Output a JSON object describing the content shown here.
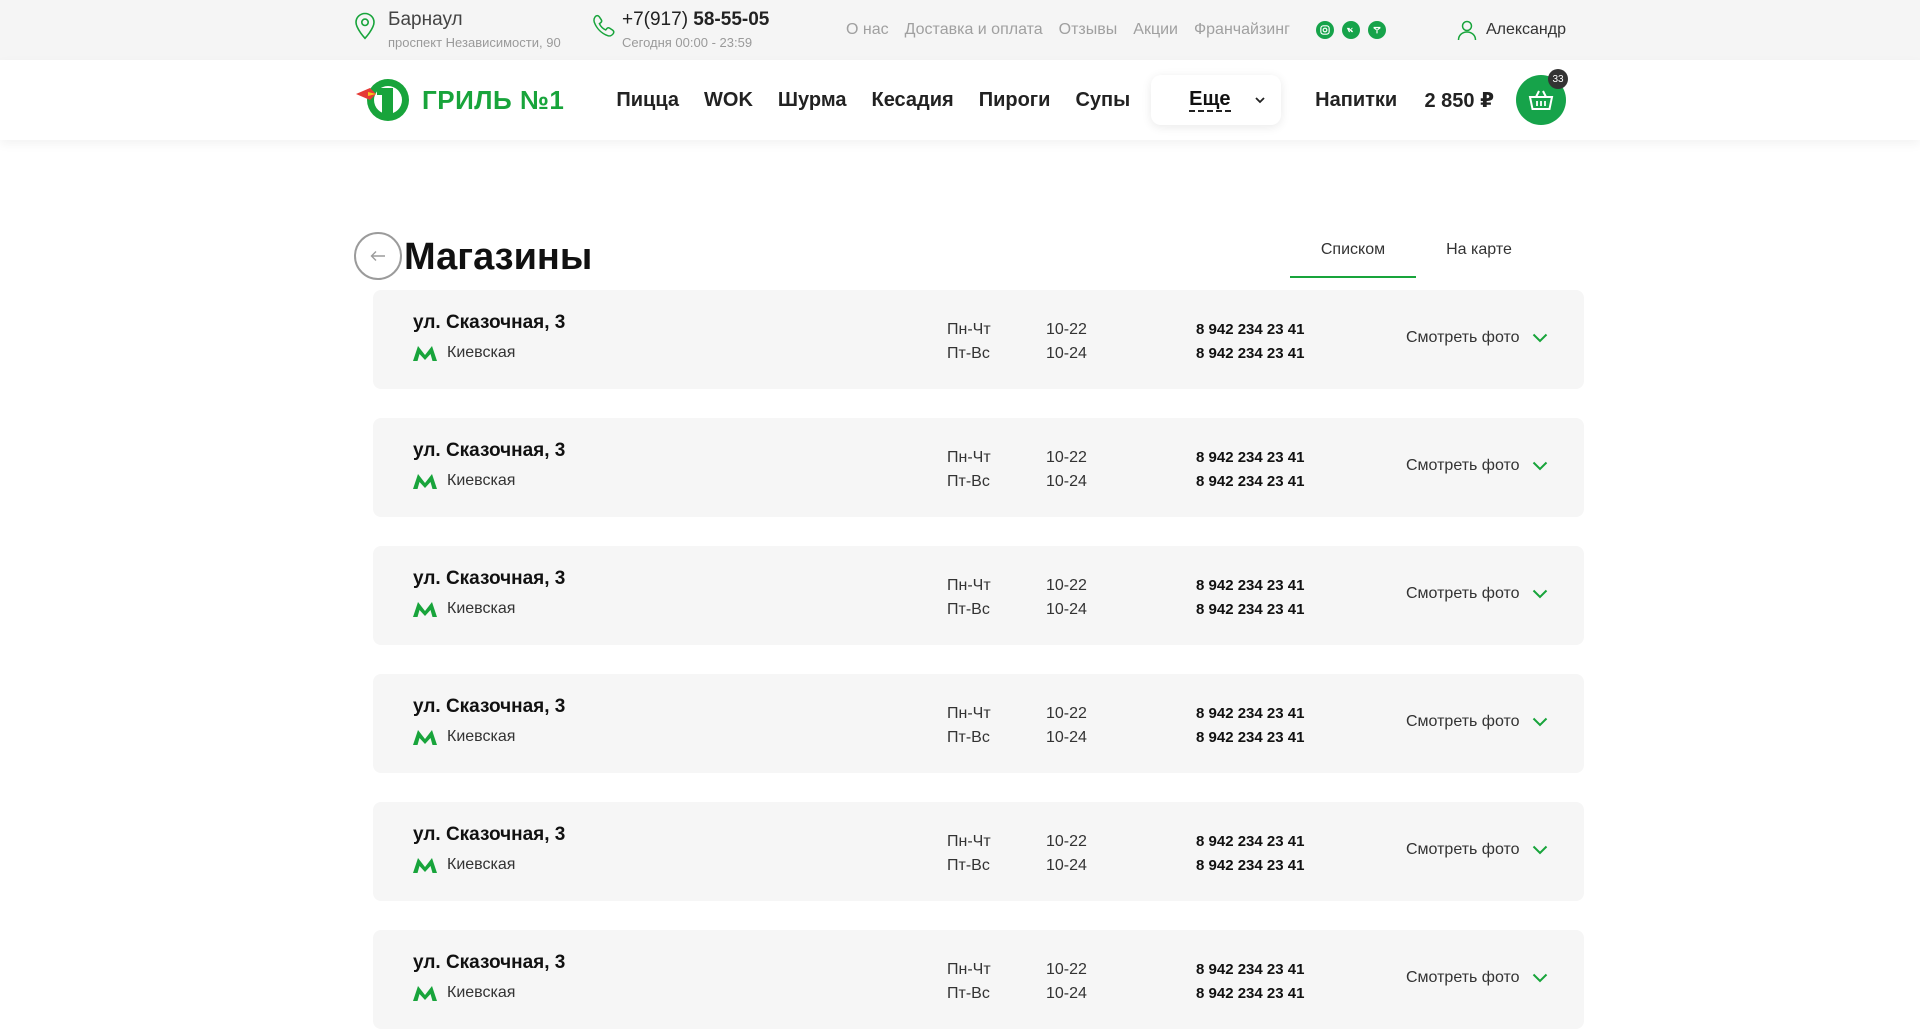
{
  "topbar": {
    "city": "Барнаул",
    "address": "проспект Независимости, 90",
    "phone_prefix": "+7(917) ",
    "phone_main": "58-55-05",
    "hours": "Сегодня 00:00 - 23:59",
    "links": [
      "О нас",
      "Доставка и оплата",
      "Отзывы",
      "Акции",
      "Франчайзинг"
    ],
    "socials": [
      "instagram-icon",
      "vk-icon",
      "telegram-icon"
    ],
    "user_name": "Александр"
  },
  "header": {
    "logo_text": "ГРИЛЬ №1",
    "nav": [
      "Пицца",
      "WOK",
      "Шурма",
      "Кесадия",
      "Пироги",
      "Супы"
    ],
    "more_label": "Еще",
    "drinks_label": "Напитки",
    "cart_total": "2 850 ₽",
    "cart_count": "33"
  },
  "page": {
    "title": "Магазины",
    "tabs": [
      "Списком",
      "На карте"
    ],
    "active_tab": 0
  },
  "stores": [
    {
      "address": "ул. Сказочная, 3",
      "metro": "Киевская",
      "days": [
        "Пн-Чт",
        "Пт-Вс"
      ],
      "times": [
        "10-22",
        "10-24"
      ],
      "phones": [
        "8 942 234 23 41",
        "8 942 234 23 41"
      ],
      "photo_label": "Смотреть фото"
    },
    {
      "address": "ул. Сказочная, 3",
      "metro": "Киевская",
      "days": [
        "Пн-Чт",
        "Пт-Вс"
      ],
      "times": [
        "10-22",
        "10-24"
      ],
      "phones": [
        "8 942 234 23 41",
        "8 942 234 23 41"
      ],
      "photo_label": "Смотреть фото"
    },
    {
      "address": "ул. Сказочная, 3",
      "metro": "Киевская",
      "days": [
        "Пн-Чт",
        "Пт-Вс"
      ],
      "times": [
        "10-22",
        "10-24"
      ],
      "phones": [
        "8 942 234 23 41",
        "8 942 234 23 41"
      ],
      "photo_label": "Смотреть фото"
    },
    {
      "address": "ул. Сказочная, 3",
      "metro": "Киевская",
      "days": [
        "Пн-Чт",
        "Пт-Вс"
      ],
      "times": [
        "10-22",
        "10-24"
      ],
      "phones": [
        "8 942 234 23 41",
        "8 942 234 23 41"
      ],
      "photo_label": "Смотреть фото"
    },
    {
      "address": "ул. Сказочная, 3",
      "metro": "Киевская",
      "days": [
        "Пн-Чт",
        "Пт-Вс"
      ],
      "times": [
        "10-22",
        "10-24"
      ],
      "phones": [
        "8 942 234 23 41",
        "8 942 234 23 41"
      ],
      "photo_label": "Смотреть фото"
    },
    {
      "address": "ул. Сказочная, 3",
      "metro": "Киевская",
      "days": [
        "Пн-Чт",
        "Пт-Вс"
      ],
      "times": [
        "10-22",
        "10-24"
      ],
      "phones": [
        "8 942 234 23 41",
        "8 942 234 23 41"
      ],
      "photo_label": "Смотреть фото"
    }
  ],
  "colors": {
    "brand_green": "#18a43b",
    "card_bg": "#f6f6f6",
    "topbar_bg": "#f5f5f5"
  }
}
